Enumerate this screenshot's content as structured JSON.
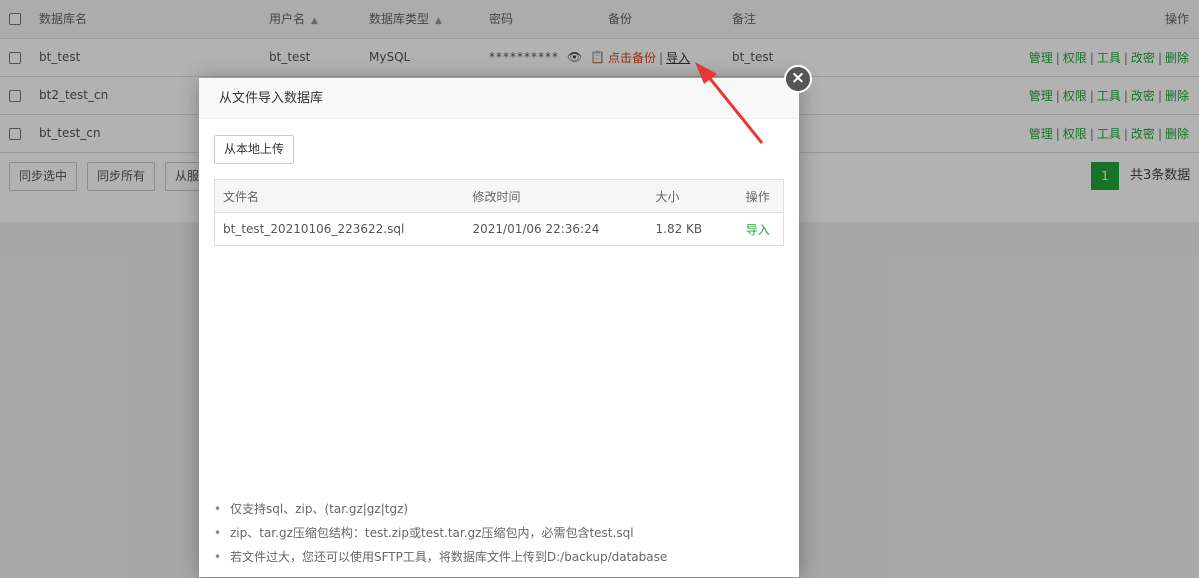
{
  "table": {
    "headers": {
      "name": "数据库名",
      "user": "用户名",
      "type": "数据库类型",
      "password": "密码",
      "backup": "备份",
      "note": "备注",
      "ops": "操作"
    },
    "rows": [
      {
        "name": "bt_test",
        "user": "bt_test",
        "type": "MySQL",
        "password": "**********",
        "backup_text": "点击备份",
        "import_text": "导入",
        "note": "bt_test"
      },
      {
        "name": "bt2_test_cn"
      },
      {
        "name": "bt_test_cn"
      }
    ],
    "ops_labels": {
      "manage": "管理",
      "perm": "权限",
      "tools": "工具",
      "change_pwd": "改密",
      "delete": "删除"
    }
  },
  "bottom": {
    "sync_selected": "同步选中",
    "sync_all": "同步所有",
    "from_server_partial": "从服",
    "page": "1",
    "total": "共3条数据"
  },
  "dialog": {
    "title": "从文件导入数据库",
    "upload_button": "从本地上传",
    "columns": {
      "filename": "文件名",
      "modified": "修改时间",
      "size": "大小",
      "op": "操作"
    },
    "files": [
      {
        "filename": "bt_test_20210106_223622.sql",
        "modified": "2021/01/06 22:36:24",
        "size": "1.82 KB",
        "op": "导入"
      }
    ],
    "tips": [
      "仅支持sql、zip、(tar.gz|gz|tgz)",
      "zip、tar.gz压缩包结构：test.zip或test.tar.gz压缩包内，必需包含test.sql",
      "若文件过大，您还可以使用SFTP工具，将数据库文件上传到D:/backup/database"
    ]
  },
  "icons": {
    "close": "close-icon",
    "eye": "eye-icon",
    "copy": "copy-icon"
  },
  "colors": {
    "accent_green": "#20a53a",
    "backup_red": "#d9431e",
    "arrow_red": "#e53935"
  }
}
